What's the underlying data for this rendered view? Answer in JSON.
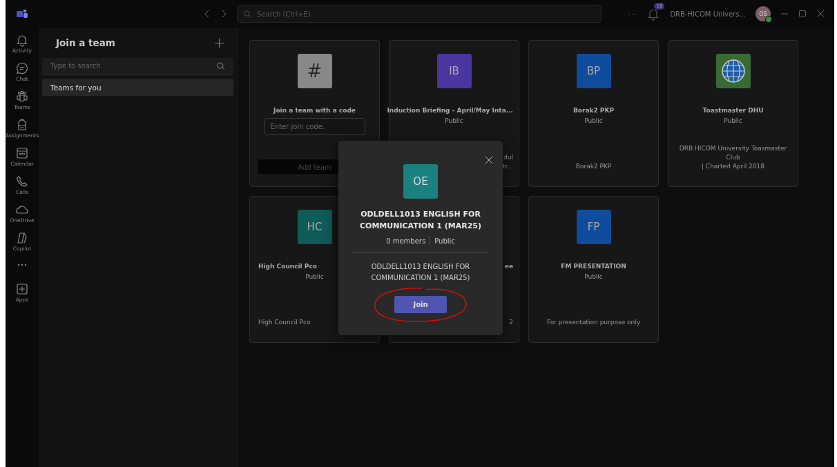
{
  "title_bar": {
    "search": {
      "placeholder": "Search (Ctrl+E)"
    },
    "more": "···",
    "notification_badge": "18",
    "org_name": "DRB-HICOM Univers...",
    "avatar": {
      "initials": "OS"
    }
  },
  "app_bar": {
    "items": [
      {
        "kind": "app",
        "label": "Activity"
      },
      {
        "kind": "app",
        "label": "Chat"
      },
      {
        "kind": "app",
        "label": "Teams"
      },
      {
        "kind": "app",
        "label": "Assignments"
      },
      {
        "kind": "app",
        "label": "Calendar"
      },
      {
        "kind": "app",
        "label": "Calls"
      },
      {
        "kind": "app",
        "label": "OneDrive"
      },
      {
        "kind": "app",
        "label": "Copilot"
      },
      {
        "kind": "more"
      },
      {
        "kind": "app",
        "label": "Apps"
      }
    ]
  },
  "panel": {
    "title": "Join a team",
    "search": {
      "placeholder": "Type to search"
    },
    "items": [
      {
        "label": "Teams for you",
        "selected": true
      }
    ]
  },
  "cards": [
    {
      "kind": "code",
      "symbol": "#",
      "title": "Join a team with a code",
      "input": {
        "placeholder": "Enter join code."
      },
      "button": {
        "label": "Add team",
        "disabled": true
      }
    },
    {
      "kind": "team",
      "initials": "IB",
      "color": "#4b35a0",
      "title": "Induction Briefing - April/May Inta...",
      "privacy": "Public",
      "description": [
        "dul",
        "tr..."
      ],
      "covered": true
    },
    {
      "kind": "team",
      "initials": "BP",
      "color": "#0f4c9e",
      "title": "Borak2 PKP",
      "privacy": "Public",
      "description": [
        "Borak2 PKP"
      ],
      "covered": false
    },
    {
      "kind": "team_image",
      "color": "#376b33",
      "title": "Toastmaster DHU",
      "privacy": "Public",
      "description": [
        "DRB HICOM University Toasmaster Club",
        "| Charted April 2018"
      ],
      "covered": false
    },
    {
      "kind": "team",
      "initials": "HC",
      "color": "#0f5b57",
      "title": "High Council Pco",
      "privacy": "Public",
      "description": [
        "High Council Pco"
      ],
      "covered": true
    },
    {
      "kind": "team",
      "title": "ee",
      "description": [
        "2"
      ],
      "covered": true
    },
    {
      "kind": "team",
      "initials": "FP",
      "color": "#0f4c9e",
      "title": "FM PRESENTATION",
      "privacy": "Public",
      "description": [
        "For presentation purpose only"
      ],
      "covered": false
    }
  ],
  "dialog": {
    "initials": "OE",
    "color": "#1a8080",
    "title": "ODLDELL1013 ENGLISH FOR COMMUNICATION 1 (MAR25)",
    "members": "0 members",
    "privacy": "Public",
    "description": "ODLDELL1013 ENGLISH FOR COMMUNICATION 1 (MAR25)",
    "join_button": "Join"
  }
}
